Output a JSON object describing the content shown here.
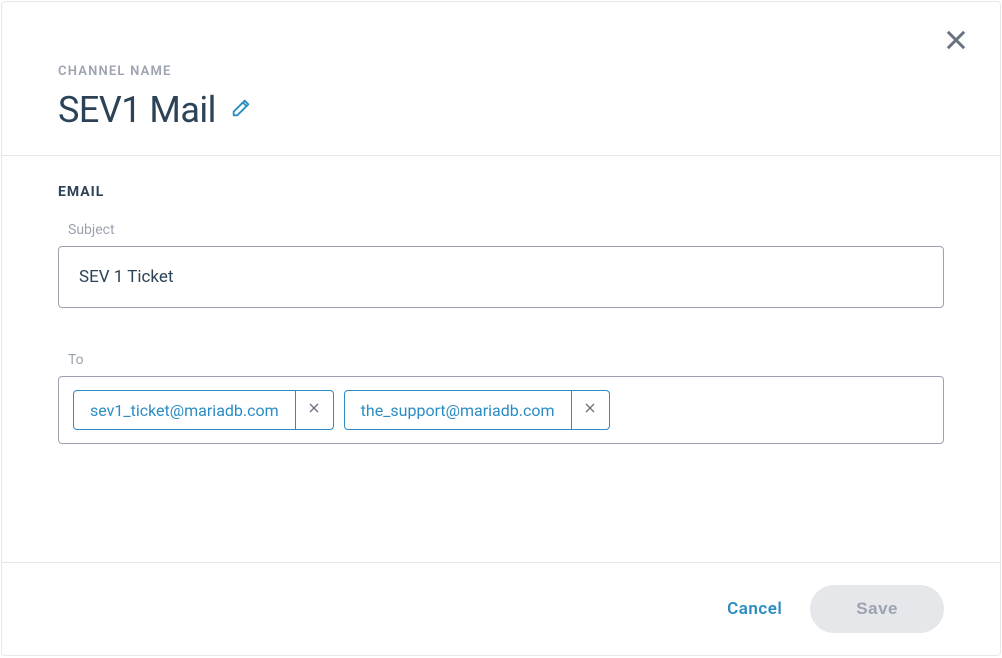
{
  "header": {
    "channel_label": "CHANNEL NAME",
    "title": "SEV1 Mail"
  },
  "email": {
    "section_heading": "EMAIL",
    "subject": {
      "label": "Subject",
      "value": "SEV 1 Ticket"
    },
    "to": {
      "label": "To",
      "recipients": [
        "sev1_ticket@mariadb.com",
        "the_support@mariadb.com"
      ]
    }
  },
  "footer": {
    "cancel_label": "Cancel",
    "save_label": "Save"
  }
}
